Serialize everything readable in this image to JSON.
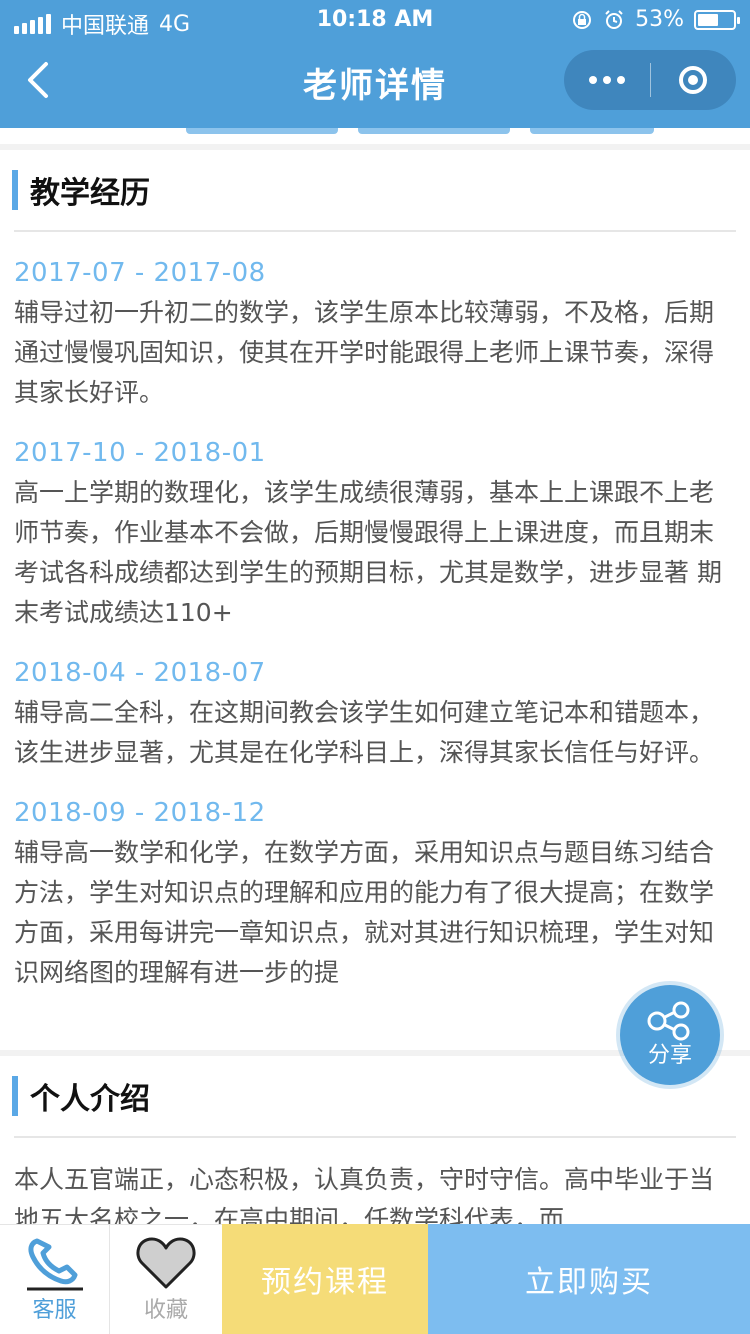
{
  "status_bar": {
    "carrier": "中国联通",
    "network": "4G",
    "time": "10:18 AM",
    "battery": "53%"
  },
  "nav": {
    "title": "老师详情"
  },
  "teaching": {
    "title": "教学经历",
    "items": [
      {
        "date": "2017-07 - 2017-08",
        "desc": "辅导过初一升初二的数学，该学生原本比较薄弱，不及格，后期通过慢慢巩固知识，使其在开学时能跟得上老师上课节奏，深得其家长好评。"
      },
      {
        "date": "2017-10 - 2018-01",
        "desc": "高一上学期的数理化，该学生成绩很薄弱，基本上上课跟不上老师节奏，作业基本不会做，后期慢慢跟得上上课进度，而且期末考试各科成绩都达到学生的预期目标，尤其是数学，进步显著 期末考试成绩达110+"
      },
      {
        "date": "2018-04 - 2018-07",
        "desc": "辅导高二全科，在这期间教会该学生如何建立笔记本和错题本，该生进步显著，尤其是在化学科目上，深得其家长信任与好评。"
      },
      {
        "date": "2018-09 - 2018-12",
        "desc": "辅导高一数学和化学，在数学方面，采用知识点与题目练习结合方法，学生对知识点的理解和应用的能力有了很大提高；在数学方面，采用每讲完一章知识点，就对其进行知识梳理，学生对知识网络图的理解有进一步的提"
      }
    ]
  },
  "intro": {
    "title": "个人介绍",
    "text": "本人五官端正，心态积极，认真负责，守时守信。高中毕业于当地五大名校之一，在高中期间，任数学科代表，而"
  },
  "share": {
    "label": "分享"
  },
  "bottom_bar": {
    "service_label": "客服",
    "favorite_label": "收藏",
    "book_label": "预约课程",
    "buy_label": "立即购买"
  },
  "colors": {
    "primary": "#4f9fd9",
    "date": "#71b9ee",
    "book": "#f5dc78",
    "buy": "#7dbdf0"
  }
}
